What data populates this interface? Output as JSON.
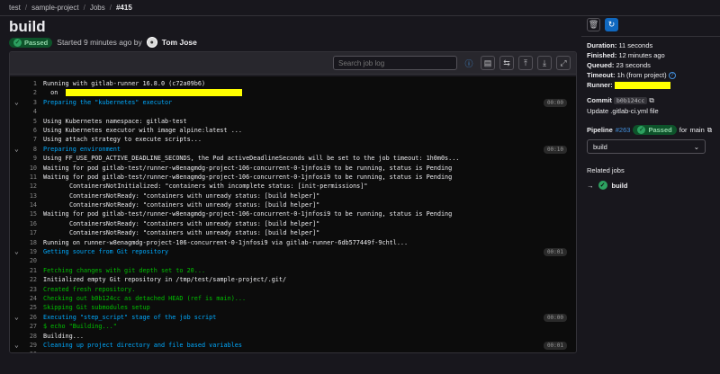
{
  "breadcrumb": [
    "test",
    "sample-project",
    "Jobs",
    "#415"
  ],
  "job": {
    "title": "build",
    "status": "Passed",
    "started_text": "Started 9 minutes ago by",
    "author": "Tom Jose"
  },
  "toolbar": {
    "search_placeholder": "Search job log"
  },
  "log_lines": [
    {
      "n": "1",
      "t": "Running with gitlab-runner 16.8.0 (c72a09b6)",
      "c": ""
    },
    {
      "n": "2",
      "t": "  on ",
      "c": "",
      "hl": 196
    },
    {
      "n": "3",
      "t": "Preparing the \"kubernetes\" executor",
      "c": "section",
      "chev": true,
      "dur": "00:00"
    },
    {
      "n": "4",
      "t": "",
      "c": ""
    },
    {
      "n": "5",
      "t": "Using Kubernetes namespace: gitlab-test",
      "c": ""
    },
    {
      "n": "6",
      "t": "Using Kubernetes executor with image alpine:latest ...",
      "c": ""
    },
    {
      "n": "7",
      "t": "Using attach strategy to execute scripts...",
      "c": ""
    },
    {
      "n": "8",
      "t": "Preparing environment",
      "c": "section",
      "chev": true,
      "dur": "00:10"
    },
    {
      "n": "9",
      "t": "Using FF_USE_POD_ACTIVE_DEADLINE_SECONDS, the Pod activeDeadlineSeconds will be set to the job timeout: 1h0m0s...",
      "c": ""
    },
    {
      "n": "10",
      "t": "Waiting for pod gitlab-test/runner-w8enagmdg-project-106-concurrent-0-1jnfosi9 to be running, status is Pending",
      "c": ""
    },
    {
      "n": "11",
      "t": "Waiting for pod gitlab-test/runner-w8enagmdg-project-106-concurrent-0-1jnfosi9 to be running, status is Pending",
      "c": ""
    },
    {
      "n": "12",
      "t": "ContainersNotInitialized: \"containers with incomplete status: [init-permissions]\"",
      "c": "indent"
    },
    {
      "n": "13",
      "t": "ContainersNotReady: \"containers with unready status: [build helper]\"",
      "c": "indent"
    },
    {
      "n": "14",
      "t": "ContainersNotReady: \"containers with unready status: [build helper]\"",
      "c": "indent"
    },
    {
      "n": "15",
      "t": "Waiting for pod gitlab-test/runner-w8enagmdg-project-106-concurrent-0-1jnfosi9 to be running, status is Pending",
      "c": ""
    },
    {
      "n": "16",
      "t": "ContainersNotReady: \"containers with unready status: [build helper]\"",
      "c": "indent"
    },
    {
      "n": "17",
      "t": "ContainersNotReady: \"containers with unready status: [build helper]\"",
      "c": "indent"
    },
    {
      "n": "18",
      "t": "Running on runner-w8enagmdg-project-106-concurrent-0-1jnfosi9 via gitlab-runner-6db577449f-9chtl...",
      "c": ""
    },
    {
      "n": "19",
      "t": "Getting source from Git repository",
      "c": "section",
      "chev": true,
      "dur": "00:01"
    },
    {
      "n": "20",
      "t": "",
      "c": ""
    },
    {
      "n": "21",
      "t": "Fetching changes with git depth set to 20...",
      "c": "green"
    },
    {
      "n": "22",
      "t": "Initialized empty Git repository in /tmp/test/sample-project/.git/",
      "c": ""
    },
    {
      "n": "23",
      "t": "Created fresh repository.",
      "c": "green"
    },
    {
      "n": "24",
      "t": "Checking out b0b124cc as detached HEAD (ref is main)...",
      "c": "green"
    },
    {
      "n": "25",
      "t": "Skipping Git submodules setup",
      "c": "green"
    },
    {
      "n": "26",
      "t": "Executing \"step_script\" stage of the job script",
      "c": "section",
      "chev": true,
      "dur": "00:00"
    },
    {
      "n": "27",
      "t": "$ echo \"Building...\"",
      "c": "green"
    },
    {
      "n": "28",
      "t": "Building...",
      "c": ""
    },
    {
      "n": "29",
      "t": "Cleaning up project directory and file based variables",
      "c": "section",
      "chev": true,
      "dur": "00:01"
    },
    {
      "n": "30",
      "t": "",
      "c": ""
    },
    {
      "n": "31",
      "t": "Job succeeded",
      "c": "green"
    }
  ],
  "sidebar": {
    "duration_label": "Duration:",
    "duration_value": "11 seconds",
    "finished_label": "Finished:",
    "finished_value": "12 minutes ago",
    "queued_label": "Queued:",
    "queued_value": "23 seconds",
    "timeout_label": "Timeout:",
    "timeout_value": "1h (from project)",
    "runner_label": "Runner:",
    "commit_label": "Commit",
    "commit_sha": "b0b124cc",
    "commit_message": "Update .gitlab-ci.yml file",
    "pipeline_label": "Pipeline",
    "pipeline_id": "#263",
    "pipeline_status": "Passed",
    "pipeline_for": "for",
    "pipeline_ref": "main",
    "stage_select": "build",
    "related_jobs_label": "Related jobs",
    "related_job": "build"
  },
  "colors": {
    "accent": "#1068bf",
    "success": "#2da160",
    "section": "#00aaff",
    "log_green": "#00c000",
    "redaction": "#ffff00"
  },
  "icons": [
    "trash-icon",
    "retry-icon",
    "help-icon",
    "scroll-top-icon",
    "scroll-bottom-icon",
    "fullscreen-icon",
    "copy-icon"
  ]
}
